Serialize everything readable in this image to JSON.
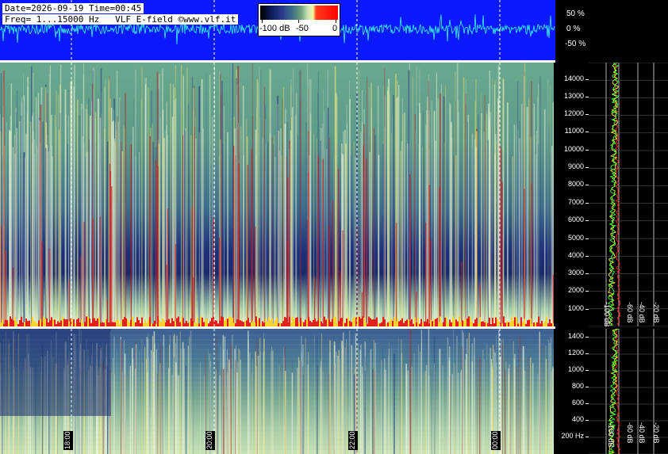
{
  "header": {
    "date_line": "Date=2026-09-19 Time=00:45",
    "freq_line": "Freq= 1...15000 Hz   VLF E-field ©www.vlf.it"
  },
  "colorbar": {
    "ticks": [
      "-100 dB",
      "-50",
      "0"
    ],
    "gradient_colors": [
      "#000000",
      "#0b1a5a",
      "#3a6a8a",
      "#cfe8b8",
      "#f5f5a0",
      "#ff0000"
    ]
  },
  "waveform_scale": [
    "50 %",
    "0 %",
    "-50 %"
  ],
  "top_freq_labels": [
    "14000",
    "13000",
    "12000",
    "11000",
    "10000",
    "9000",
    "8000",
    "7000",
    "6000",
    "5000",
    "4000",
    "3000",
    "2000",
    "1000"
  ],
  "bottom_freq_labels": [
    "1400",
    "1200",
    "1000",
    "800",
    "600",
    "400",
    "200 Hz"
  ],
  "top_db_labels": [
    "-100 dB",
    "-60 dB",
    "-40 dB",
    "-20 dB"
  ],
  "bottom_db_labels": [
    "-100 dB",
    "-60 dB",
    "-40 dB",
    "-20 dB"
  ],
  "time_labels": [
    "18:00",
    "20:00",
    "22:00",
    "00:00"
  ],
  "colors": {
    "waveform_bg": "#0b19ff",
    "waveform_trace": "#39f5e6",
    "spectrum_trace_1": "#ffff33",
    "spectrum_trace_2": "#33ff33",
    "spectrum_trace_3": "#ff2a2a"
  }
}
